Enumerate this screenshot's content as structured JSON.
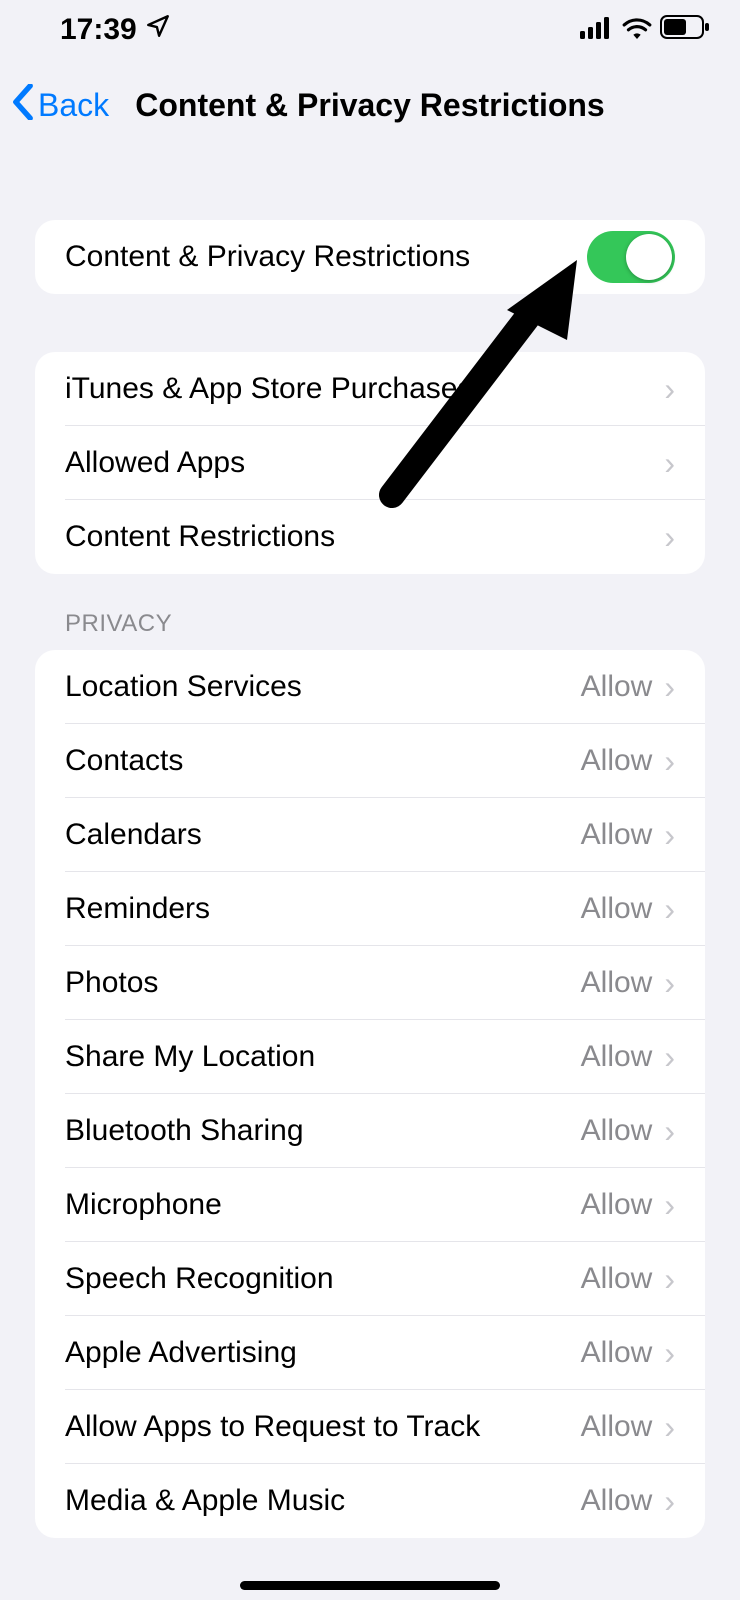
{
  "status": {
    "time": "17:39"
  },
  "nav": {
    "back": "Back",
    "title": "Content & Privacy Restrictions"
  },
  "toggle_row": {
    "label": "Content & Privacy Restrictions",
    "on": true
  },
  "section1": {
    "items": [
      {
        "label": "iTunes & App Store Purchases"
      },
      {
        "label": "Allowed Apps"
      },
      {
        "label": "Content Restrictions"
      }
    ]
  },
  "privacy": {
    "header": "PRIVACY",
    "items": [
      {
        "label": "Location Services",
        "value": "Allow"
      },
      {
        "label": "Contacts",
        "value": "Allow"
      },
      {
        "label": "Calendars",
        "value": "Allow"
      },
      {
        "label": "Reminders",
        "value": "Allow"
      },
      {
        "label": "Photos",
        "value": "Allow"
      },
      {
        "label": "Share My Location",
        "value": "Allow"
      },
      {
        "label": "Bluetooth Sharing",
        "value": "Allow"
      },
      {
        "label": "Microphone",
        "value": "Allow"
      },
      {
        "label": "Speech Recognition",
        "value": "Allow"
      },
      {
        "label": "Apple Advertising",
        "value": "Allow"
      },
      {
        "label": "Allow Apps to Request to Track",
        "value": "Allow"
      },
      {
        "label": "Media & Apple Music",
        "value": "Allow"
      }
    ]
  }
}
